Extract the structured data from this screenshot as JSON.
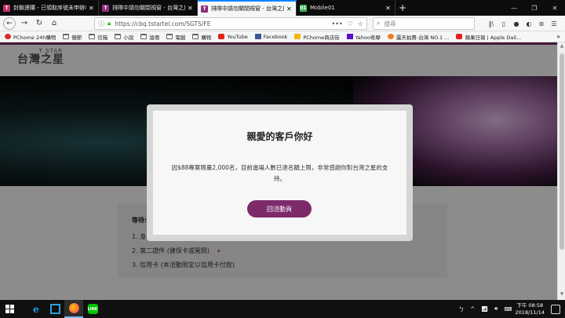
{
  "browser": {
    "tabs": [
      {
        "title": "封鎖連購 - 已領取序號未申辦者",
        "icon": "pink-favicon",
        "active": false
      },
      {
        "title": "排隊中請勿關閉視窗 - 台灣之星",
        "icon": "tstar-favicon",
        "active": false
      },
      {
        "title": "排隊中請勿關閉視窗 - 台灣之星",
        "icon": "tstar-favicon",
        "active": true
      },
      {
        "title": "Mobile01",
        "icon": "mobile01-favicon",
        "active": false
      }
    ],
    "new_tab": "+",
    "url": "https://cbq.tstartel.com/SGTS/FE",
    "url_actions": [
      "•••",
      "♡",
      "☆"
    ],
    "search_placeholder": "搜尋",
    "bookmarks": [
      {
        "label": "PChome 24h購物",
        "icon": "pc"
      },
      {
        "label": "黴節",
        "icon": "folder"
      },
      {
        "label": "信箱",
        "icon": "folder"
      },
      {
        "label": "小說",
        "icon": "folder"
      },
      {
        "label": "論壇",
        "icon": "folder"
      },
      {
        "label": "電腦",
        "icon": "folder"
      },
      {
        "label": "購物",
        "icon": "folder"
      },
      {
        "label": "YouTube",
        "icon": "red"
      },
      {
        "label": "Facebook",
        "icon": "blue"
      },
      {
        "label": "PChome商店街",
        "icon": "yel"
      },
      {
        "label": "Yahoo奇摩",
        "icon": "pur"
      },
      {
        "label": "露天拍賣-台灣 NO.1 ...",
        "icon": "org"
      },
      {
        "label": "蘋果日報 | Apple Dail...",
        "icon": "red"
      }
    ]
  },
  "page": {
    "logo_top": "T STAR",
    "logo_bottom": "台灣之星",
    "wait_label": "等待:",
    "list_items": [
      "1. 身",
      "2. 第二證件 (健保卡或駕照)",
      "3. 信用卡 (本活動限定以信用卡付款)"
    ]
  },
  "modal": {
    "title": "親愛的客戶你好",
    "message": "因$88專案限量2,000名，目前進場人數已達名額上限，非常感謝你對台灣之星的支持。",
    "button": "回活動頁"
  },
  "taskbar": {
    "ime": "ㄅ",
    "clock_time": "下午 08:58",
    "clock_date": "2018/11/14"
  },
  "colors": {
    "accent": "#7c2a6a",
    "tab_active_border": "#0a84ff"
  }
}
